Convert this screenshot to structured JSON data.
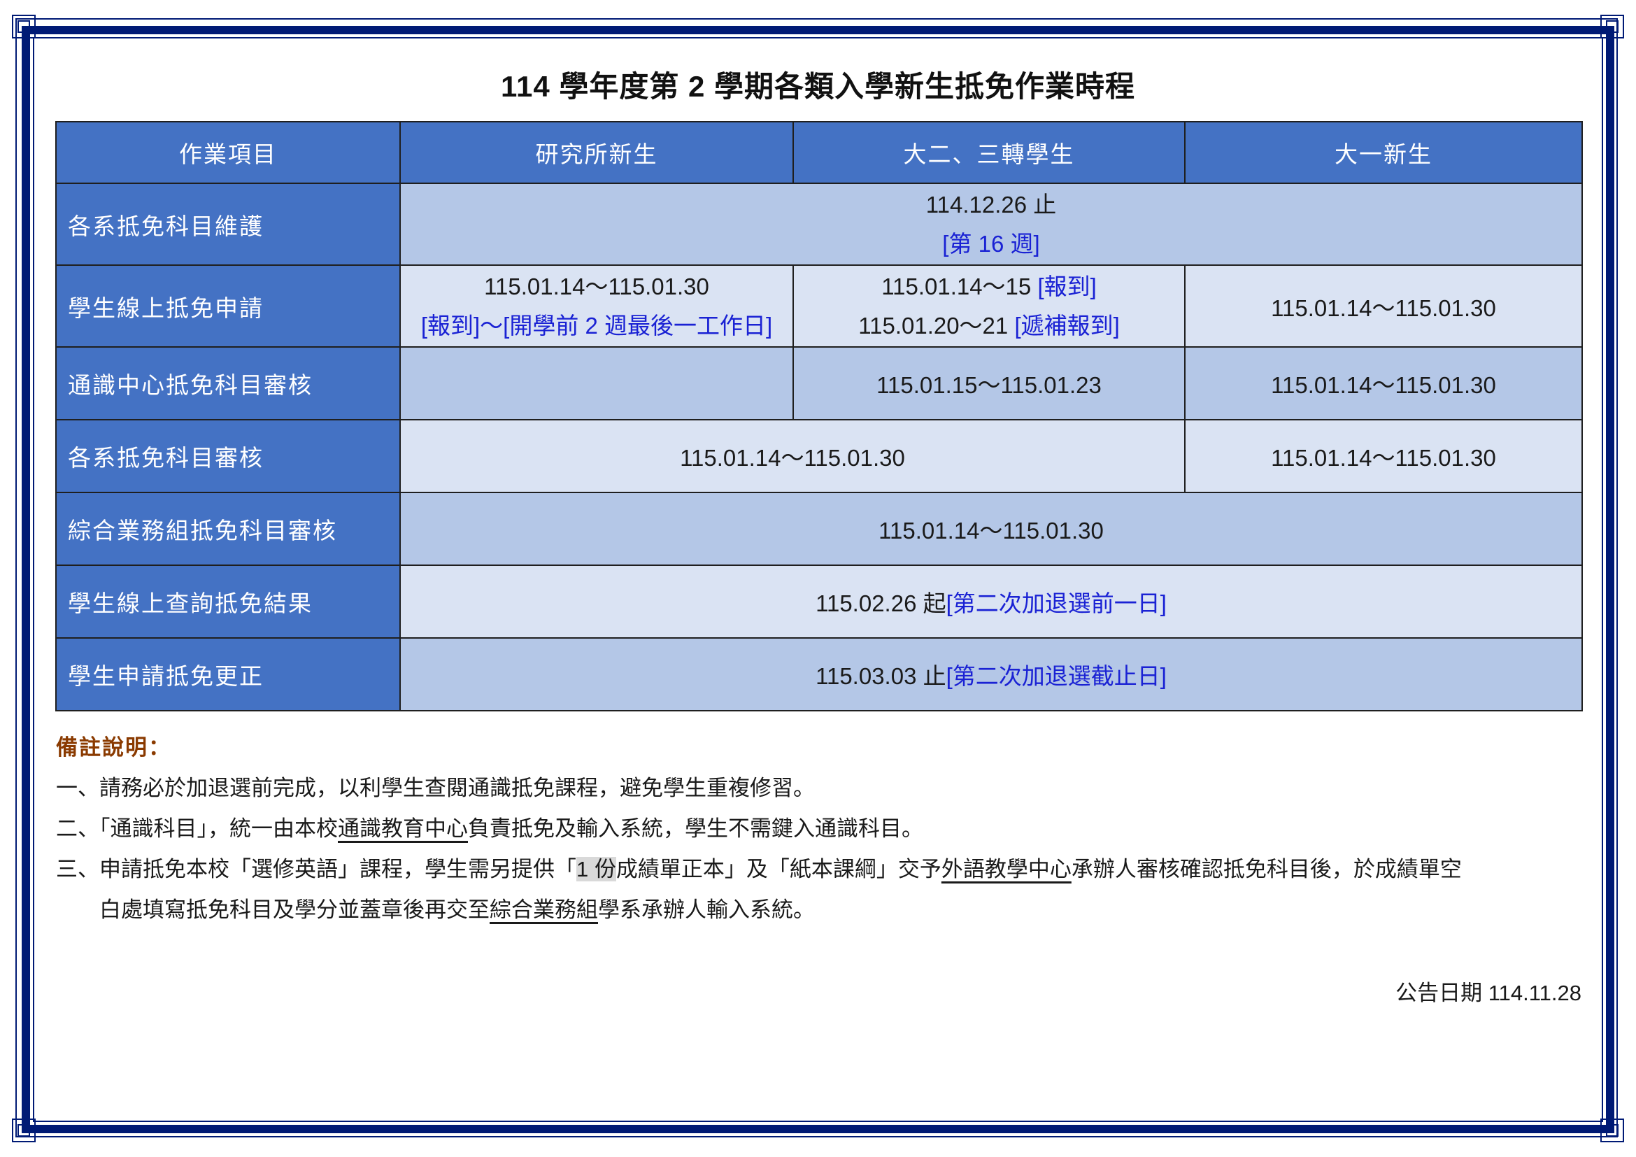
{
  "title": "114 學年度第 2 學期各類入學新生抵免作業時程",
  "table": {
    "headers": [
      "作業項目",
      "研究所新生",
      "大二、三轉學生",
      "大一新生"
    ],
    "rows": {
      "r1": {
        "label": "各系抵免科目維護",
        "all_line1": "114.12.26 止",
        "all_line2": "[第 16 週]"
      },
      "r2": {
        "label": "學生線上抵免申請",
        "grad_line1": "115.01.14～115.01.30",
        "grad_line2": "[報到]～[開學前 2 週最後一工作日]",
        "transfer_a_date": "115.01.14～15 ",
        "transfer_a_note": "[報到]",
        "transfer_b_date": "115.01.20～21 ",
        "transfer_b_note": "[遞補報到]",
        "fresh": "115.01.14～115.01.30"
      },
      "r3": {
        "label": "通識中心抵免科目審核",
        "grad": "",
        "transfer": "115.01.15～115.01.23",
        "fresh": "115.01.14～115.01.30"
      },
      "r4": {
        "label": "各系抵免科目審核",
        "grad_transfer": "115.01.14～115.01.30",
        "fresh": "115.01.14～115.01.30"
      },
      "r5": {
        "label": "綜合業務組抵免科目審核",
        "all": "115.01.14～115.01.30"
      },
      "r6": {
        "label": "學生線上查詢抵免結果",
        "all_date": "115.02.26 起",
        "all_note": "[第二次加退選前一日]"
      },
      "r7": {
        "label": "學生申請抵免更正",
        "all_date": "115.03.03 止",
        "all_note": "[第二次加退選截止日]"
      }
    }
  },
  "notes": {
    "heading": "備註說明：",
    "n1": "一、請務必於加退選前完成，以利學生查閱通識抵免課程，避免學生重複修習。",
    "n2_a": "二、「通識科目」，統一由本校",
    "n2_u": "通識教育中心",
    "n2_b": "負責抵免及輸入系統，學生不需鍵入通識科目。",
    "n3_a": "三、申請抵免本校「選修英語」課程，學生需另提供「",
    "n3_hl": "1 份",
    "n3_b": "成績單正本」及「紙本課綱」交予",
    "n3_u1": "外語教學中心",
    "n3_c": "承辦人審核確認抵免科目後，於成績單空",
    "n3_d": "白處填寫抵免科目及學分並蓋章後再交至",
    "n3_u2": "綜合業務組",
    "n3_e": "學系承辦人輸入系統。"
  },
  "announce": "公告日期 114.11.28",
  "colors": {
    "header_bg": "#4472c4",
    "cell_dark": "#b4c7e7",
    "cell_light": "#dae3f3",
    "frame": "#001a75",
    "note_blue": "#1a22d4",
    "heading_brown": "#8a3a00"
  }
}
